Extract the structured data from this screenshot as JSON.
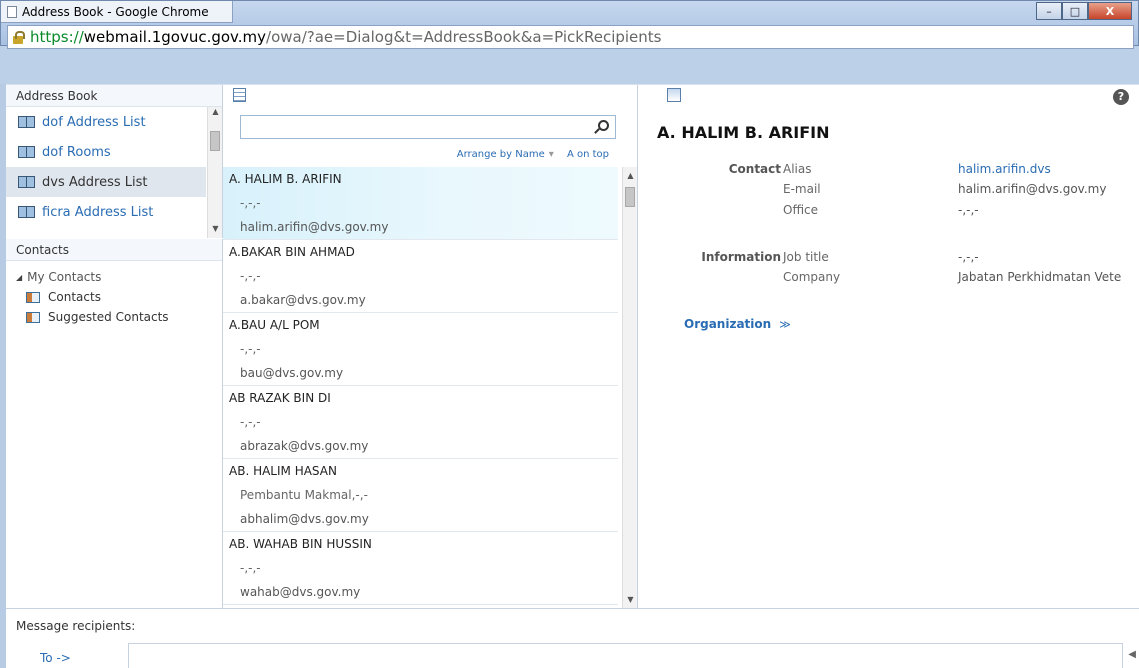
{
  "window": {
    "title": "Address Book - Google Chrome",
    "minimize": "–",
    "maximize": "□",
    "close": "X"
  },
  "url": {
    "scheme": "https://",
    "host": "webmail.1govuc.gov.my",
    "path": "/owa/?ae=Dialog&t=AddressBook&a=PickRecipients"
  },
  "address_book": {
    "header": "Address Book",
    "lists": [
      {
        "label": "dof Address List"
      },
      {
        "label": "dof Rooms"
      },
      {
        "label": "dvs Address List"
      },
      {
        "label": "ficra Address List"
      }
    ],
    "selected_index": 2
  },
  "contacts_panel": {
    "header": "Contacts",
    "root": "My Contacts",
    "children": [
      "Contacts",
      "Suggested Contacts"
    ]
  },
  "search": {
    "value": "",
    "placeholder": ""
  },
  "arrange": {
    "by": "Arrange by Name",
    "order": "A on top"
  },
  "contacts": [
    {
      "name": "A. HALIM B. ARIFIN",
      "line": "-,-,-",
      "email": "halim.arifin@dvs.gov.my"
    },
    {
      "name": "A.BAKAR BIN AHMAD",
      "line": "-,-,-",
      "email": "a.bakar@dvs.gov.my"
    },
    {
      "name": "A.BAU A/L POM",
      "line": "-,-,-",
      "email": "bau@dvs.gov.my"
    },
    {
      "name": "AB RAZAK BIN DI",
      "line": "-,-,-",
      "email": "abrazak@dvs.gov.my"
    },
    {
      "name": "AB. HALIM HASAN",
      "line": "Pembantu Makmal,-,-",
      "email": "abhalim@dvs.gov.my"
    },
    {
      "name": "AB. WAHAB BIN HUSSIN",
      "line": "-,-,-",
      "email": "wahab@dvs.gov.my"
    }
  ],
  "details": {
    "name": "A. HALIM B. ARIFIN",
    "contact_section": "Contact",
    "alias_label": "Alias",
    "alias": "halim.arifin.dvs",
    "email_label": "E-mail",
    "email": "halim.arifin@dvs.gov.my",
    "office_label": "Office",
    "office": "-,-,-",
    "info_section": "Information",
    "jobtitle_label": "Job title",
    "jobtitle": "-,-,-",
    "company_label": "Company",
    "company": "Jabatan Perkhidmatan Vete",
    "organization": "Organization",
    "help": "?"
  },
  "recipients": {
    "label": "Message recipients:",
    "to": "To ->"
  }
}
